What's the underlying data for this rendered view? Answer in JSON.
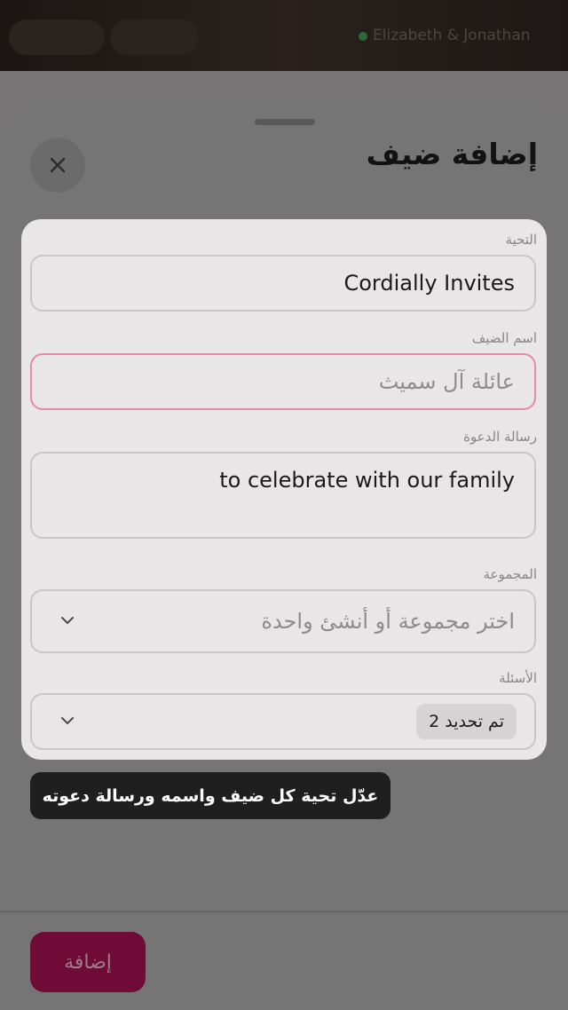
{
  "background": {
    "host_name": "Elizabeth & Jonathan"
  },
  "sheet": {
    "title": "إضافة ضيف",
    "close_icon": "close-icon",
    "add_button_label": "إضافة"
  },
  "form": {
    "greeting": {
      "label": "التحية",
      "value": "Cordially Invites"
    },
    "guest_name": {
      "label": "اسم الضيف",
      "placeholder": "عائلة آل سميث"
    },
    "invitation_message": {
      "label": "رسالة الدعوة",
      "value": "to celebrate with our family"
    },
    "group": {
      "label": "المجموعة",
      "placeholder": "اختر مجموعة أو أنشئ واحدة"
    },
    "questions": {
      "label": "الأسئلة",
      "selected_badge": "تم تحديد 2"
    }
  },
  "tooltip": {
    "text": "عدّل تحية كل ضيف واسمه ورسالة دعوته"
  },
  "colors": {
    "accent": "#6f0b36",
    "error_border": "#e58aa9",
    "card_bg": "#e8e6e7",
    "overlay": "#767575"
  }
}
